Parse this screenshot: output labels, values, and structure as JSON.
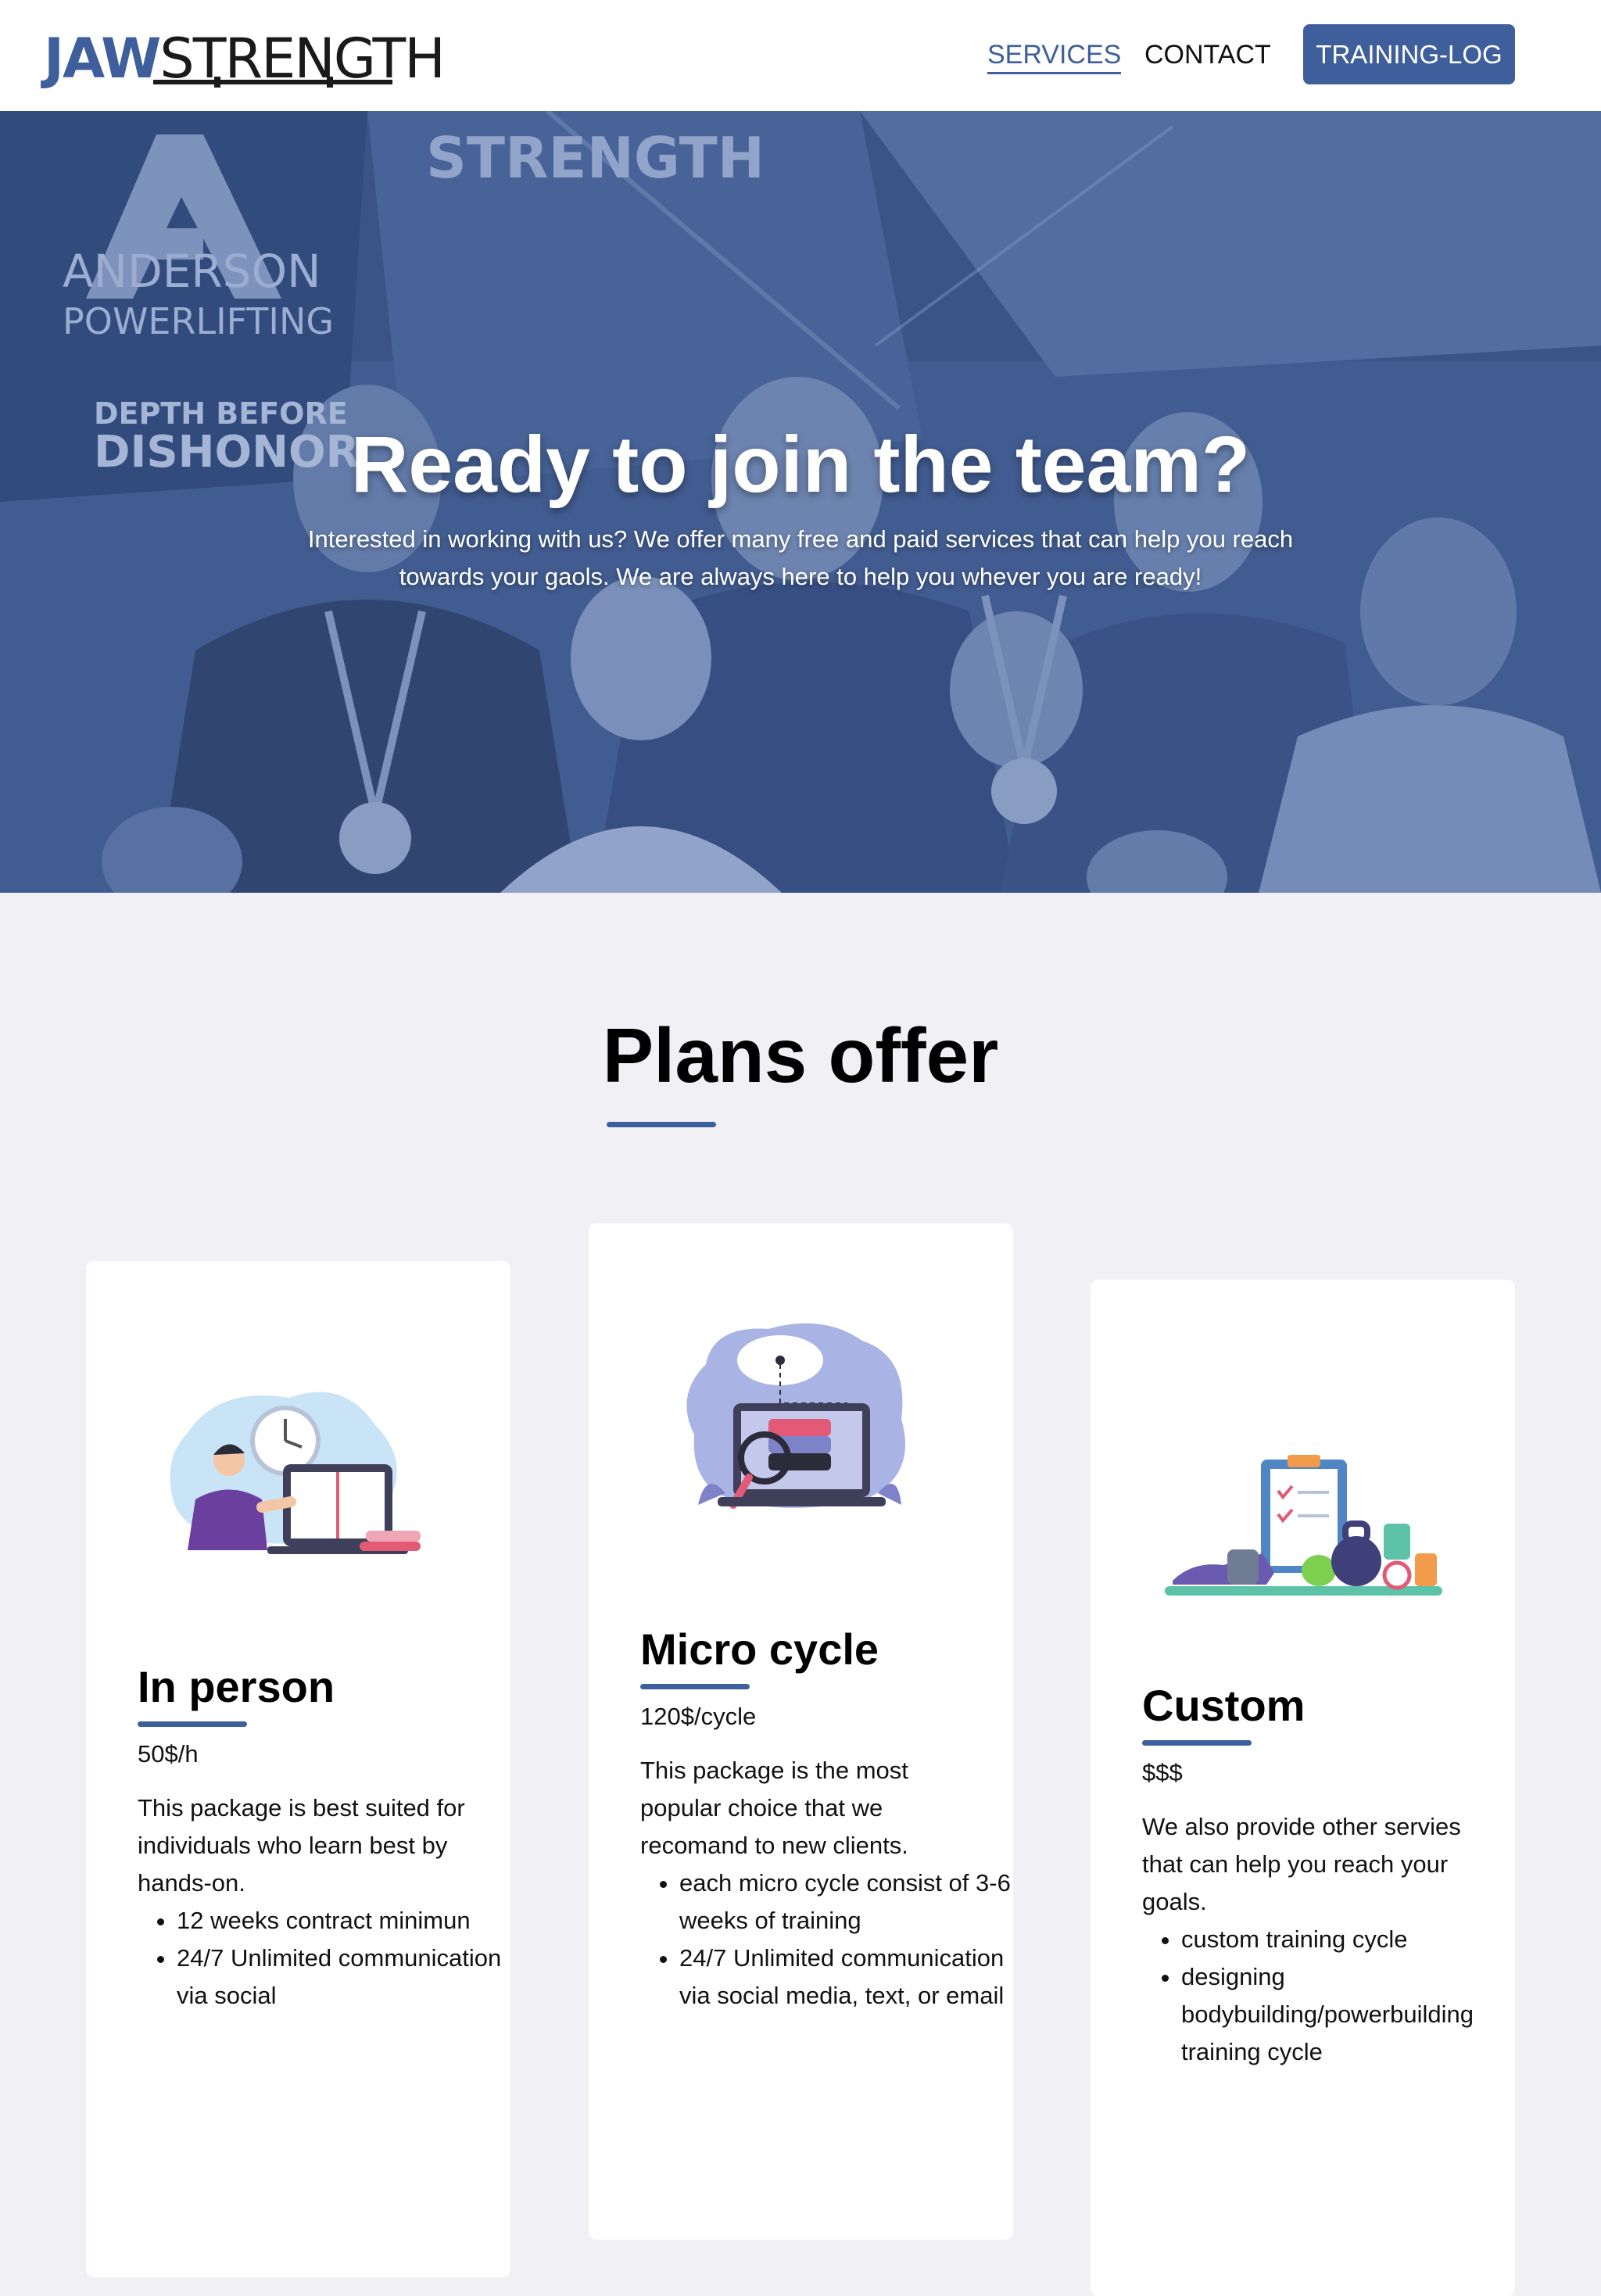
{
  "header": {
    "logo": {
      "jaw": "JAW",
      "strength": "STRENGTH"
    },
    "nav": [
      {
        "label": "SERVICES"
      },
      {
        "label": "CONTACT"
      }
    ],
    "cta_label": "TRAINING-LOG",
    "accent_color": "#3e5f9c"
  },
  "hero": {
    "title": "Ready to join the team?",
    "subtitle": "Interested in working with us? We offer many free and paid services that can help you reach towards your gaols. We are always here to help you whever you are ready!",
    "banner_text": {
      "org": "ANDERSON",
      "org_sub": "POWERLIFTING",
      "motto_1": "DEPTH BEFORE",
      "motto_2": "DISHONOR",
      "backdrop": "STRENGTH"
    }
  },
  "plans": {
    "title": "Plans offer",
    "cards": [
      {
        "title": "In person",
        "price": "50$/h",
        "description": "This package is best suited for individuals who learn best by hands-on.",
        "features": [
          "12 weeks contract minimun",
          "24/7 Unlimited communication via social"
        ],
        "illustration": "person-with-laptop-illustration"
      },
      {
        "title": "Micro cycle",
        "price": "120$/cycle",
        "description": "This package is the most popular choice that we recomand to new clients.",
        "features": [
          "each micro cycle consist of 3-6 weeks of training",
          "24/7 Unlimited communication via social media, text, or email"
        ],
        "illustration": "cloud-laptop-search-illustration"
      },
      {
        "title": "Custom",
        "price": "$$$",
        "description": "We also provide other servies that can help you reach your goals.",
        "features": [
          "custom training cycle",
          "designing bodybuilding/powerbuilding training cycle"
        ],
        "illustration": "fitness-equipment-illustration"
      }
    ]
  }
}
